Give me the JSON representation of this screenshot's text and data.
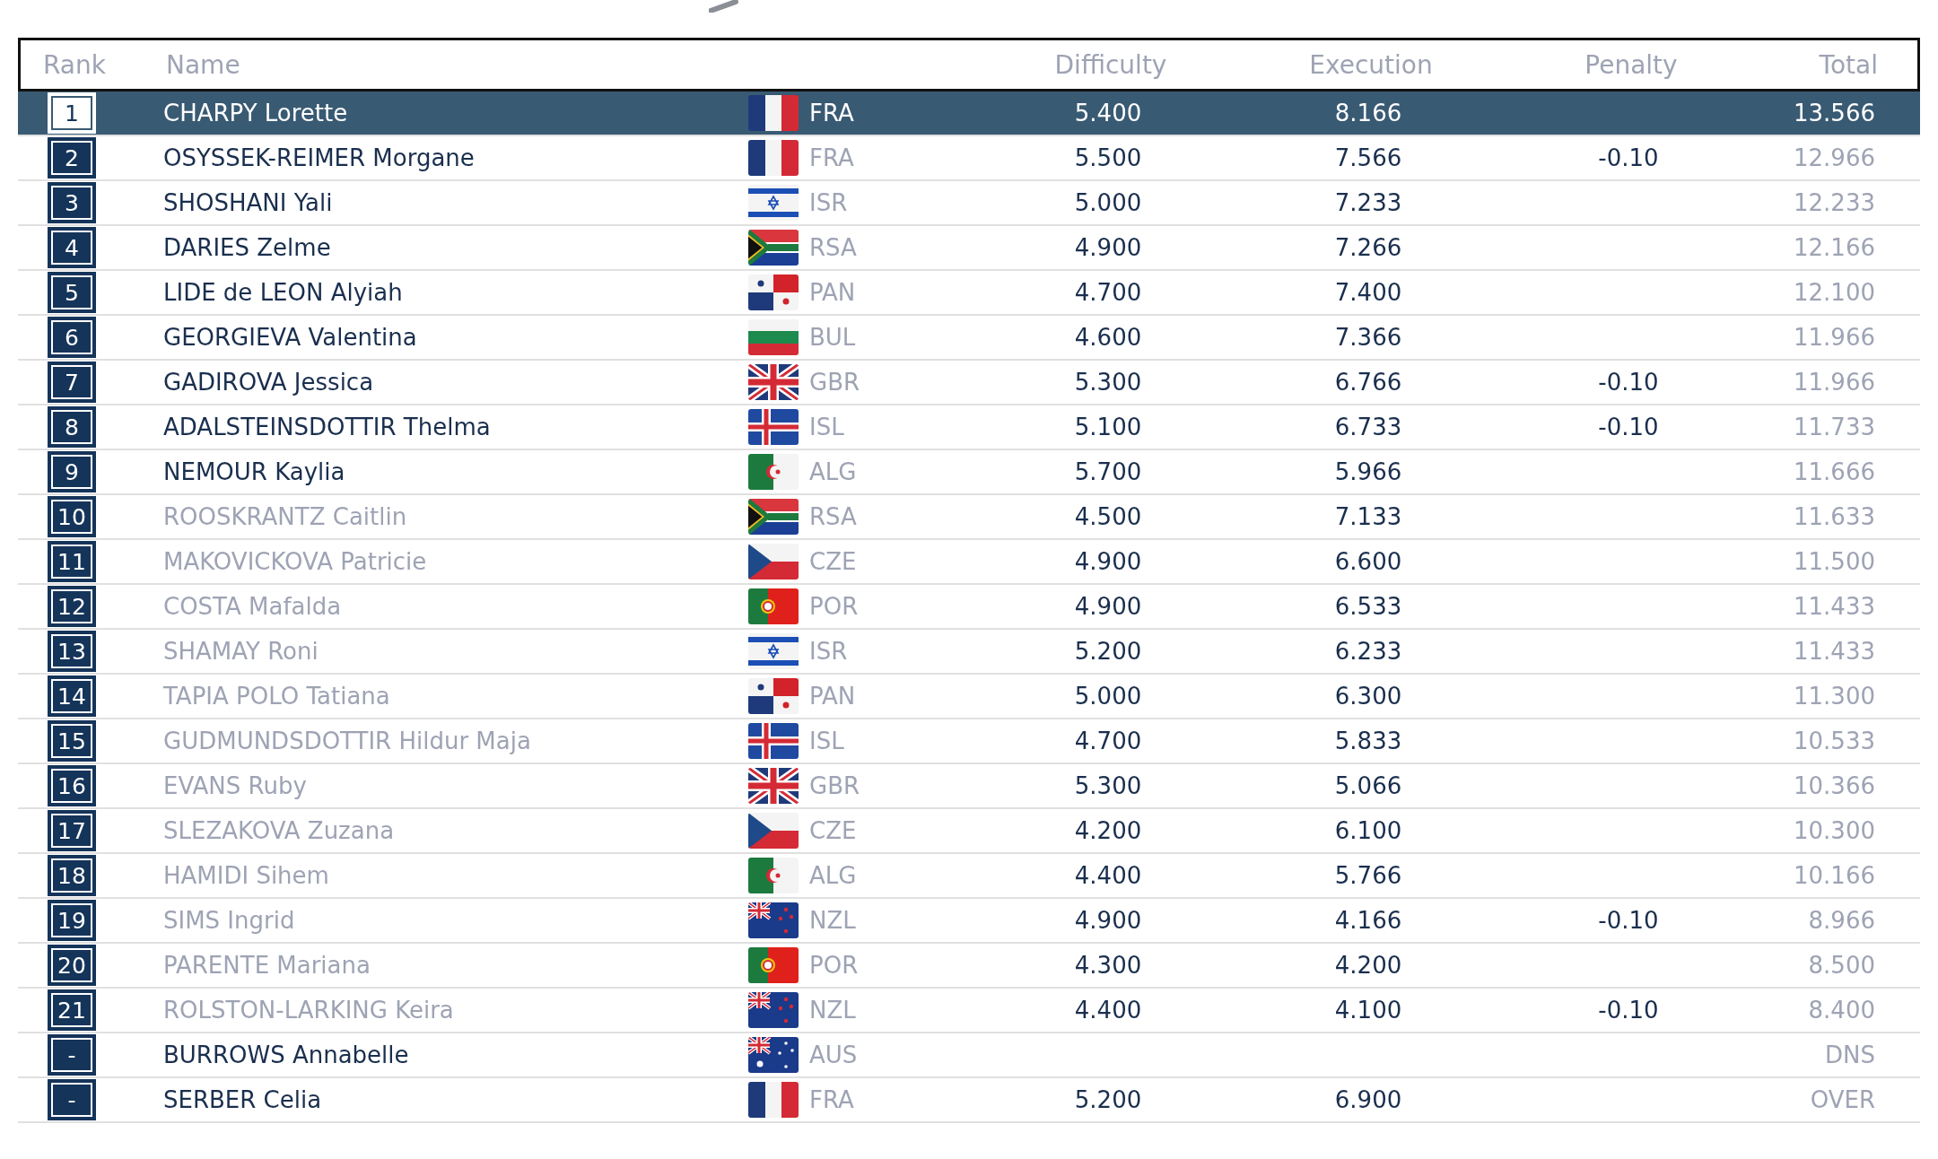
{
  "table": {
    "columns": [
      "Rank",
      "Name",
      "Difficulty",
      "Execution",
      "Penalty",
      "Total"
    ],
    "rows": [
      {
        "rank": "1",
        "name": "CHARPY Lorette",
        "nation": "FRA",
        "difficulty": "5.400",
        "execution": "8.166",
        "penalty": "",
        "total": "13.566",
        "selected": true,
        "qualified": true
      },
      {
        "rank": "2",
        "name": "OSYSSEK-REIMER Morgane",
        "nation": "FRA",
        "difficulty": "5.500",
        "execution": "7.566",
        "penalty": "-0.10",
        "total": "12.966",
        "selected": false,
        "qualified": true
      },
      {
        "rank": "3",
        "name": "SHOSHANI Yali",
        "nation": "ISR",
        "difficulty": "5.000",
        "execution": "7.233",
        "penalty": "",
        "total": "12.233",
        "selected": false,
        "qualified": true
      },
      {
        "rank": "4",
        "name": "DARIES Zelme",
        "nation": "RSA",
        "difficulty": "4.900",
        "execution": "7.266",
        "penalty": "",
        "total": "12.166",
        "selected": false,
        "qualified": true
      },
      {
        "rank": "5",
        "name": "LIDE de LEON Alyiah",
        "nation": "PAN",
        "difficulty": "4.700",
        "execution": "7.400",
        "penalty": "",
        "total": "12.100",
        "selected": false,
        "qualified": true
      },
      {
        "rank": "6",
        "name": "GEORGIEVA Valentina",
        "nation": "BUL",
        "difficulty": "4.600",
        "execution": "7.366",
        "penalty": "",
        "total": "11.966",
        "selected": false,
        "qualified": true
      },
      {
        "rank": "7",
        "name": "GADIROVA Jessica",
        "nation": "GBR",
        "difficulty": "5.300",
        "execution": "6.766",
        "penalty": "-0.10",
        "total": "11.966",
        "selected": false,
        "qualified": true
      },
      {
        "rank": "8",
        "name": "ADALSTEINSDOTTIR Thelma",
        "nation": "ISL",
        "difficulty": "5.100",
        "execution": "6.733",
        "penalty": "-0.10",
        "total": "11.733",
        "selected": false,
        "qualified": true
      },
      {
        "rank": "9",
        "name": "NEMOUR Kaylia",
        "nation": "ALG",
        "difficulty": "5.700",
        "execution": "5.966",
        "penalty": "",
        "total": "11.666",
        "selected": false,
        "qualified": true
      },
      {
        "rank": "10",
        "name": "ROOSKRANTZ Caitlin",
        "nation": "RSA",
        "difficulty": "4.500",
        "execution": "7.133",
        "penalty": "",
        "total": "11.633",
        "selected": false,
        "qualified": false
      },
      {
        "rank": "11",
        "name": "MAKOVICKOVA Patricie",
        "nation": "CZE",
        "difficulty": "4.900",
        "execution": "6.600",
        "penalty": "",
        "total": "11.500",
        "selected": false,
        "qualified": false
      },
      {
        "rank": "12",
        "name": "COSTA Mafalda",
        "nation": "POR",
        "difficulty": "4.900",
        "execution": "6.533",
        "penalty": "",
        "total": "11.433",
        "selected": false,
        "qualified": false
      },
      {
        "rank": "13",
        "name": "SHAMAY Roni",
        "nation": "ISR",
        "difficulty": "5.200",
        "execution": "6.233",
        "penalty": "",
        "total": "11.433",
        "selected": false,
        "qualified": false
      },
      {
        "rank": "14",
        "name": "TAPIA POLO Tatiana",
        "nation": "PAN",
        "difficulty": "5.000",
        "execution": "6.300",
        "penalty": "",
        "total": "11.300",
        "selected": false,
        "qualified": false
      },
      {
        "rank": "15",
        "name": "GUDMUNDSDOTTIR Hildur Maja",
        "nation": "ISL",
        "difficulty": "4.700",
        "execution": "5.833",
        "penalty": "",
        "total": "10.533",
        "selected": false,
        "qualified": false
      },
      {
        "rank": "16",
        "name": "EVANS Ruby",
        "nation": "GBR",
        "difficulty": "5.300",
        "execution": "5.066",
        "penalty": "",
        "total": "10.366",
        "selected": false,
        "qualified": false
      },
      {
        "rank": "17",
        "name": "SLEZAKOVA Zuzana",
        "nation": "CZE",
        "difficulty": "4.200",
        "execution": "6.100",
        "penalty": "",
        "total": "10.300",
        "selected": false,
        "qualified": false
      },
      {
        "rank": "18",
        "name": "HAMIDI Sihem",
        "nation": "ALG",
        "difficulty": "4.400",
        "execution": "5.766",
        "penalty": "",
        "total": "10.166",
        "selected": false,
        "qualified": false
      },
      {
        "rank": "19",
        "name": "SIMS Ingrid",
        "nation": "NZL",
        "difficulty": "4.900",
        "execution": "4.166",
        "penalty": "-0.10",
        "total": "8.966",
        "selected": false,
        "qualified": false
      },
      {
        "rank": "20",
        "name": "PARENTE Mariana",
        "nation": "POR",
        "difficulty": "4.300",
        "execution": "4.200",
        "penalty": "",
        "total": "8.500",
        "selected": false,
        "qualified": false
      },
      {
        "rank": "21",
        "name": "ROLSTON-LARKING Keira",
        "nation": "NZL",
        "difficulty": "4.400",
        "execution": "4.100",
        "penalty": "-0.10",
        "total": "8.400",
        "selected": false,
        "qualified": false
      },
      {
        "rank": "-",
        "name": "BURROWS Annabelle",
        "nation": "AUS",
        "difficulty": "",
        "execution": "",
        "penalty": "",
        "total": "DNS",
        "selected": false,
        "qualified": true
      },
      {
        "rank": "-",
        "name": "SERBER Celia",
        "nation": "FRA",
        "difficulty": "5.200",
        "execution": "6.900",
        "penalty": "",
        "total": "OVER",
        "selected": false,
        "qualified": true
      }
    ]
  }
}
